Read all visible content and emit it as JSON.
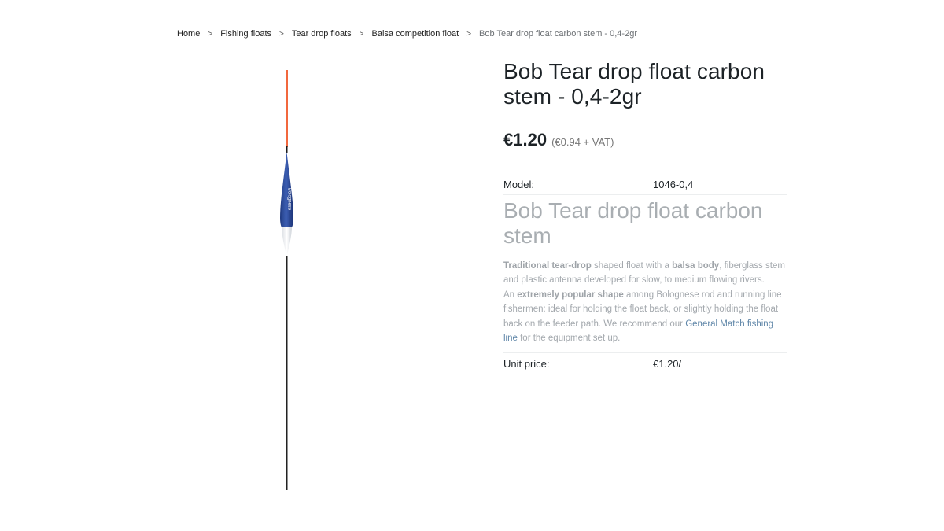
{
  "breadcrumb": {
    "items": [
      {
        "label": "Home"
      },
      {
        "label": "Fishing floats"
      },
      {
        "label": "Tear drop floats"
      },
      {
        "label": "Balsa competition float"
      }
    ],
    "current": "Bob Tear drop float carbon stem - 0,4-2gr",
    "separator": ">"
  },
  "product": {
    "title": "Bob Tear drop float carbon stem - 0,4-2gr",
    "price": "€1.20",
    "price_net": "(€0.94 + VAT)",
    "model_label": "Model:",
    "model_value": "1046-0,4",
    "unit_price_label": "Unit price:",
    "unit_price_value": "€1.20/",
    "image_brand_text": "Bolognese",
    "colors": {
      "antenna": "#f2683e",
      "body": "#2c4a9a",
      "stem": "#222222"
    }
  },
  "description": {
    "title": "Bob Tear drop float carbon stem",
    "p1": {
      "b1": "Traditional tear-drop",
      "t1": " shaped float with a ",
      "b2": "balsa body",
      "t2": ", fiberglass stem and plastic antenna developed for slow, to medium flowing rivers."
    },
    "p2": {
      "t1": "An ",
      "b1": "extremely popular shape",
      "t2": " among Bolognese rod and running line fishermen: ideal for holding the float back, or slightly holding the float back on the feeder path. We recommend our ",
      "link": "General Match fishing line",
      "t3": " for the equipment set up."
    }
  }
}
